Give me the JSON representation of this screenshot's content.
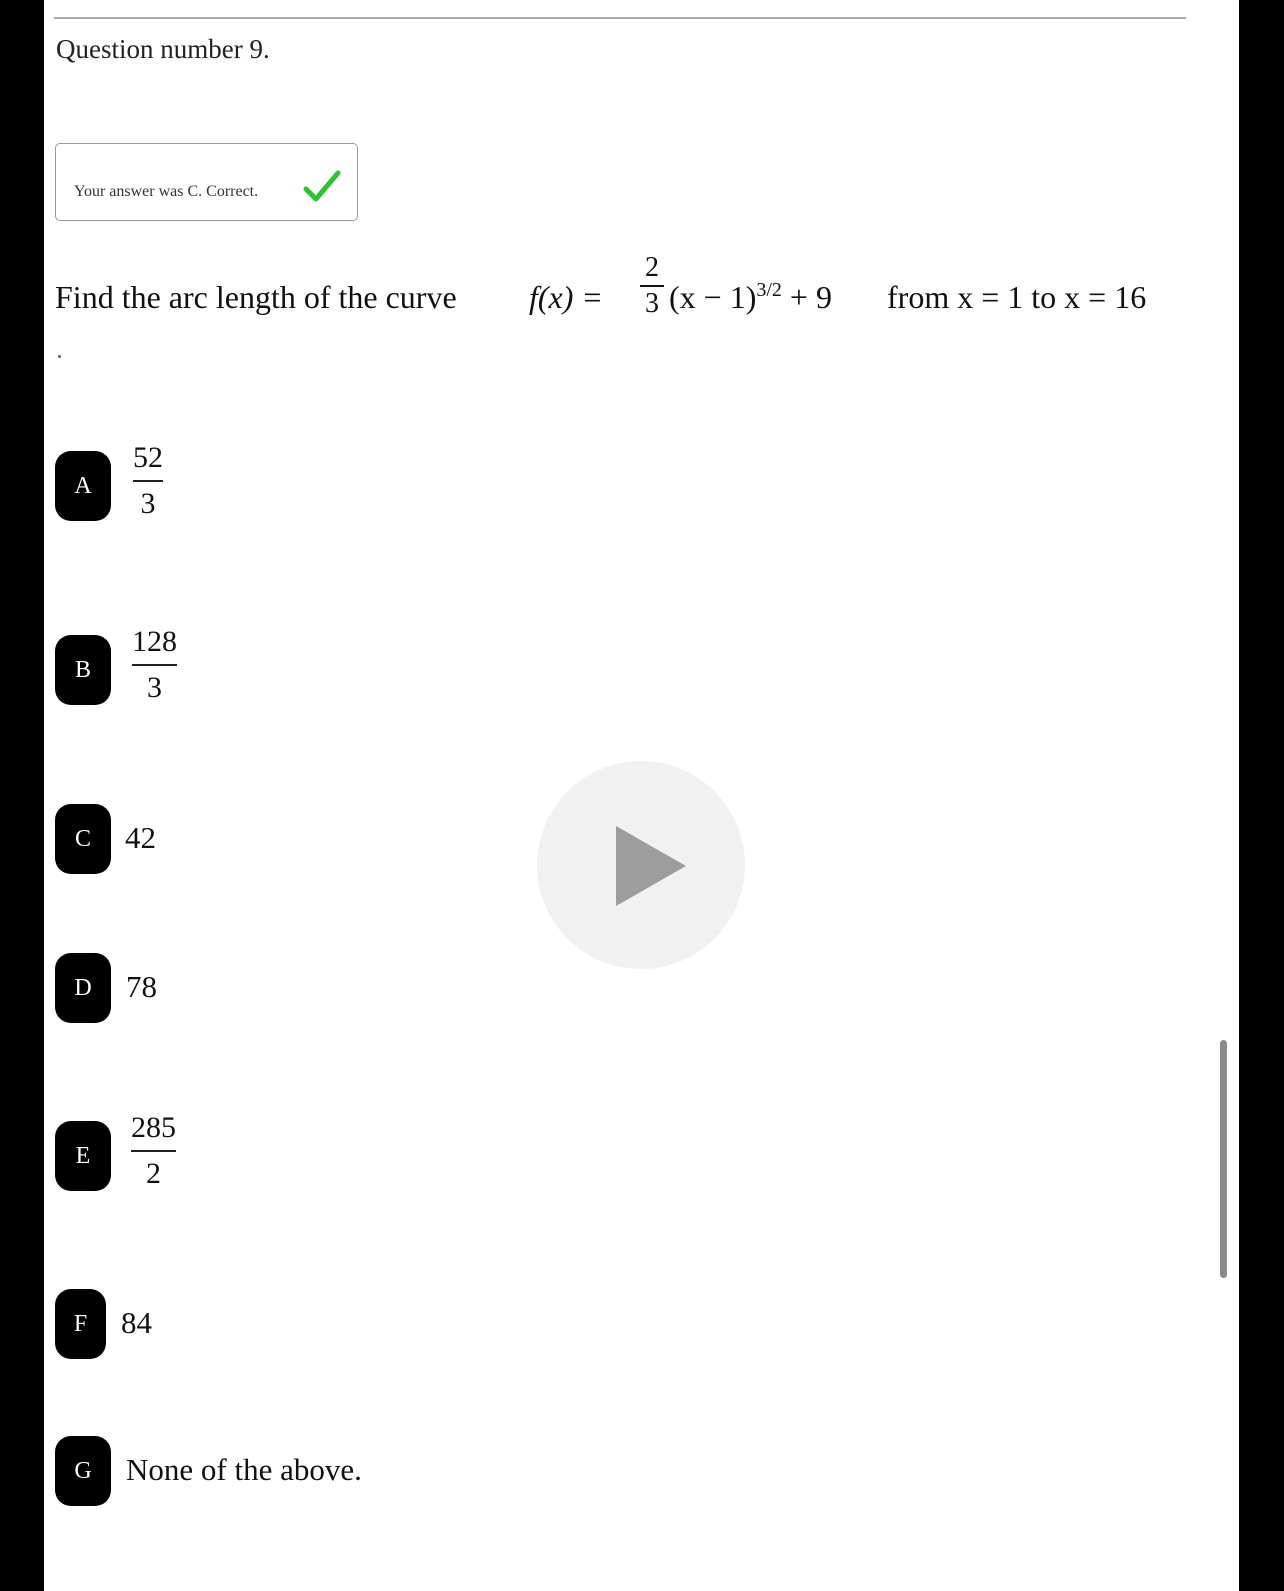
{
  "question": {
    "number_label": "Question number 9.",
    "prompt_text": "Find the arc length of the curve",
    "function_lhs": "f(x) =",
    "coef_num": "2",
    "coef_den": "3",
    "function_rest": "(x − 1)",
    "exponent": "3/2",
    "function_tail": "+ 9",
    "range_text": "from  x = 1  to  x = 16"
  },
  "feedback": {
    "text": "Your answer was C. Correct."
  },
  "colors": {
    "check": "#2fc12f",
    "badge": "#000000",
    "play_overlay": "#f1f1f1"
  },
  "options": [
    {
      "letter": "A",
      "num": "52",
      "den": "3"
    },
    {
      "letter": "B",
      "num": "128",
      "den": "3"
    },
    {
      "letter": "C",
      "value": "42"
    },
    {
      "letter": "D",
      "value": "78"
    },
    {
      "letter": "E",
      "num": "285",
      "den": "2"
    },
    {
      "letter": "F",
      "value": "84"
    },
    {
      "letter": "G",
      "value": "None of the above."
    }
  ]
}
